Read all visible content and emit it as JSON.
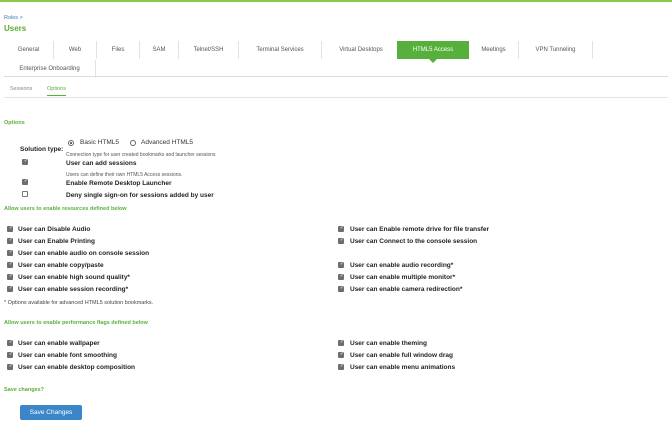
{
  "breadcrumb": "Roles >",
  "page_title": "Users",
  "tabs": [
    "General",
    "Web",
    "Files",
    "SAM",
    "Telnet/SSH",
    "Terminal Services",
    "Virtual Desktops",
    "HTML5 Access",
    "Meetings",
    "VPN Tunneling",
    "Enterprise Onboarding"
  ],
  "active_tab": "HTML5 Access",
  "subtabs": [
    "Sessions",
    "Options"
  ],
  "active_subtab": "Options",
  "options_heading": "Options",
  "solution": {
    "label": "Solution type:",
    "basic": "Basic HTML5",
    "advanced": "Advanced HTML5",
    "selected": "Basic HTML5",
    "hint": "Connection type for user created bookmarks and launcher sessions"
  },
  "general_options": [
    {
      "label": "User can add sessions",
      "checked": true,
      "hint": "Users can define their own HTML5 Access sessions."
    },
    {
      "label": "Enable Remote Desktop Launcher",
      "checked": true
    },
    {
      "label": "Deny single sign-on for sessions added by user",
      "checked": false
    }
  ],
  "resources": {
    "heading": "Allow users to enable resources defined below",
    "left": [
      "User can Disable Audio",
      "User can Enable Printing",
      "User can enable audio on console session",
      "User can enable copy/paste",
      "User can enable high sound quality*",
      "User can enable session recording*"
    ],
    "right": [
      "User can Enable remote drive for file transfer",
      "User can Connect to the console session",
      "",
      "User can enable audio recording*",
      "User can enable multiple monitor*",
      "User can enable camera redirection*"
    ]
  },
  "footnote": "* Options available for advanced HTML5 solution bookmarks.",
  "performance": {
    "heading": "Allow users to enable performance flags defined below",
    "left": [
      "User can enable wallpaper",
      "User can enable font smoothing",
      "User can enable desktop composition"
    ],
    "right": [
      "User can enable theming",
      "User can enable full window drag",
      "User can enable menu animations"
    ]
  },
  "save_heading": "Save changes?",
  "save_button": "Save Changes",
  "colors": {
    "accent": "#58b03c",
    "button": "#3a86c8",
    "link": "#3a7bbf"
  }
}
